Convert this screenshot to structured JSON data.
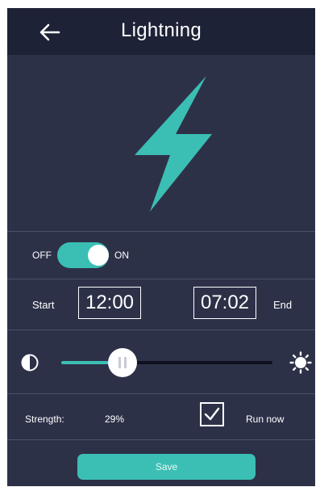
{
  "header": {
    "title": "Lightning",
    "back_icon": "arrow-left-icon"
  },
  "hero": {
    "icon": "lightning-bolt-icon",
    "color": "#3bbfb4"
  },
  "power": {
    "off_label": "OFF",
    "on_label": "ON",
    "state": "on"
  },
  "schedule": {
    "start_label": "Start",
    "start_time": "12:00",
    "end_time": "07:02",
    "end_label": "End"
  },
  "brightness": {
    "left_icon": "contrast-icon",
    "right_icon": "sun-icon",
    "level": 0.29
  },
  "strength": {
    "label": "Strength:",
    "value": "29%"
  },
  "run_now": {
    "label": "Run now",
    "checked": true
  },
  "save_label": "Save",
  "colors": {
    "accent": "#3bbfb4",
    "background": "#2d3148",
    "header": "#1e2236"
  }
}
